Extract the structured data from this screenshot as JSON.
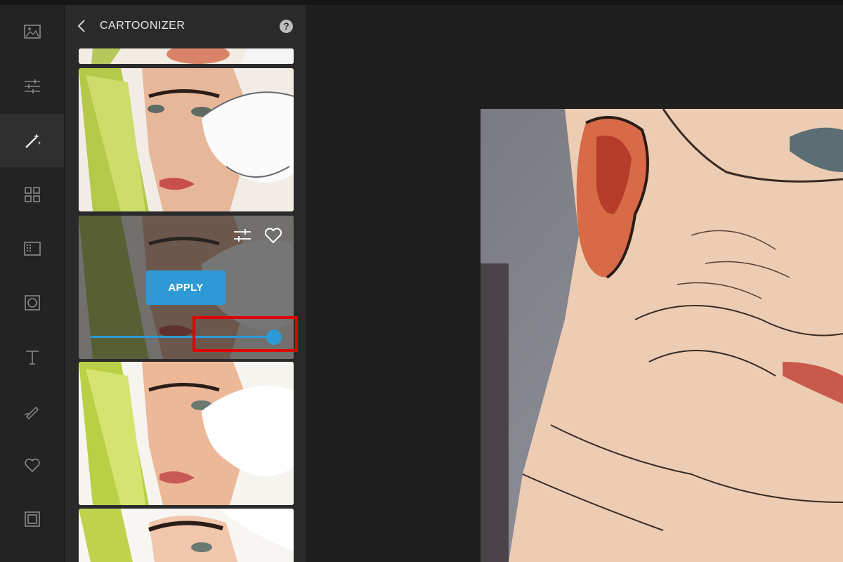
{
  "panel": {
    "title": "CARTOONIZER",
    "help": "?",
    "apply_label": "APPLY",
    "intensity": 0.95
  },
  "rail": {
    "items": [
      {
        "icon": "image-icon"
      },
      {
        "icon": "adjust-sliders-icon"
      },
      {
        "icon": "magic-wand-icon",
        "active": true
      },
      {
        "icon": "grid-icon"
      },
      {
        "icon": "texture-icon"
      },
      {
        "icon": "frame-circle-icon"
      },
      {
        "icon": "text-icon"
      },
      {
        "icon": "draw-icon"
      },
      {
        "icon": "heart-icon"
      },
      {
        "icon": "border-icon"
      }
    ]
  },
  "colors": {
    "accent": "#2d9ad6",
    "highlight": "#e00000"
  }
}
